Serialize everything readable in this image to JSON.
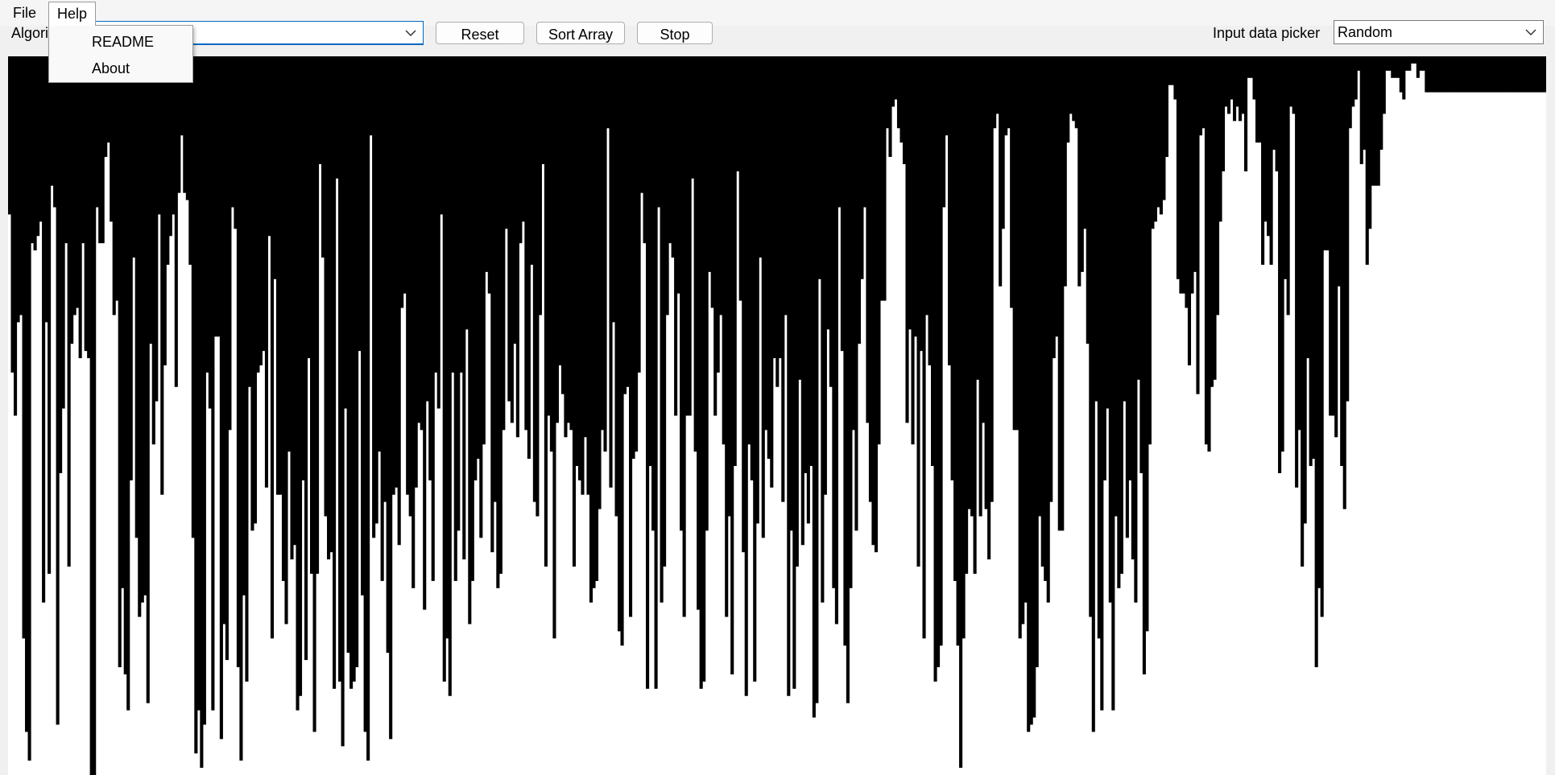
{
  "menu": {
    "file_label": "File",
    "help_label": "Help",
    "help_items": [
      "README",
      "About"
    ]
  },
  "toolbar": {
    "algorithm_label": "Algorithm",
    "algorithm_value": "",
    "reset_label": "Reset",
    "sort_label": "Sort Array",
    "stop_label": "Stop",
    "input_picker_label": "Input data picker",
    "input_picker_value": "Random"
  },
  "colors": {
    "bar": "#000000",
    "canvas_background": "#ffffff",
    "accent": "#0067c0"
  },
  "chart_data": {
    "type": "bar",
    "orientation": "hanging-from-top",
    "ylim": [
      0,
      100
    ],
    "values": [
      22,
      44,
      50,
      37,
      36,
      81,
      94,
      98,
      26,
      27,
      25,
      23,
      76,
      37,
      72,
      18,
      21,
      93,
      58,
      49,
      26,
      71,
      40,
      36,
      35,
      42,
      26,
      41,
      42,
      100,
      100,
      21,
      26,
      26,
      14,
      12,
      23,
      36,
      34,
      85,
      74,
      86,
      91,
      59,
      28,
      67,
      78,
      76,
      75,
      90,
      40,
      54,
      48,
      22,
      61,
      43,
      29,
      25,
      22,
      46,
      19,
      11,
      19,
      20,
      29,
      67,
      97,
      91,
      99,
      93,
      44,
      49,
      91,
      39,
      39,
      95,
      79,
      84,
      52,
      21,
      24,
      85,
      98,
      75,
      87,
      46,
      66,
      65,
      44,
      43,
      41,
      60,
      25,
      81,
      31,
      61,
      61,
      73,
      79,
      55,
      70,
      68,
      91,
      89,
      59,
      84,
      42,
      72,
      94,
      72,
      15,
      28,
      64,
      70,
      69,
      88,
      17,
      87,
      96,
      49,
      83,
      88,
      87,
      85,
      41,
      75,
      94,
      98,
      11,
      67,
      65,
      55,
      73,
      62,
      83,
      95,
      61,
      60,
      68,
      35,
      33,
      61,
      64,
      74,
      60,
      51,
      52,
      77,
      48,
      59,
      73,
      44,
      49,
      22,
      87,
      81,
      89,
      44,
      73,
      66,
      44,
      70,
      38,
      79,
      73,
      59,
      56,
      67,
      54,
      30,
      33,
      69,
      62,
      74,
      72,
      52,
      24,
      48,
      51,
      40,
      53,
      26,
      23,
      52,
      56,
      29,
      62,
      64,
      36,
      15,
      71,
      50,
      55,
      81,
      51,
      43,
      47,
      53,
      51,
      52,
      71,
      57,
      59,
      61,
      53,
      61,
      76,
      74,
      73,
      63,
      52,
      55,
      10,
      60,
      37,
      64,
      80,
      82,
      47,
      46,
      78,
      56,
      55,
      44,
      19,
      26,
      88,
      57,
      66,
      88,
      21,
      76,
      71,
      36,
      26,
      28,
      50,
      33,
      66,
      78,
      50,
      50,
      17,
      55,
      77,
      88,
      87,
      66,
      30,
      35,
      50,
      44,
      36,
      54,
      78,
      64,
      86,
      57,
      16,
      34,
      69,
      89,
      54,
      59,
      87,
      65,
      28,
      67,
      52,
      56,
      60,
      42,
      46,
      42,
      62,
      36,
      89,
      66,
      88,
      71,
      45,
      68,
      58,
      65,
      57,
      92,
      90,
      31,
      76,
      61,
      38,
      46,
      74,
      79,
      21,
      41,
      82,
      90,
      74,
      52,
      66,
      40,
      31,
      21,
      51,
      62,
      68,
      69,
      54,
      34,
      34,
      10,
      14,
      7,
      6,
      10,
      12,
      15,
      51,
      38,
      54,
      39,
      71,
      41,
      81,
      36,
      43,
      57,
      87,
      85,
      82,
      21,
      11,
      43,
      59,
      73,
      82,
      99,
      81,
      72,
      63,
      64,
      72,
      45,
      64,
      51,
      63,
      70,
      62,
      10,
      8,
      32,
      24,
      11,
      10,
      35,
      52,
      52,
      81,
      79,
      76,
      94,
      93,
      92,
      85,
      64,
      71,
      73,
      76,
      62,
      42,
      39,
      66,
      66,
      32,
      12,
      8,
      9,
      10,
      32,
      30,
      24,
      40,
      78,
      94,
      48,
      81,
      91,
      59,
      49,
      76,
      91,
      64,
      74,
      72,
      48,
      67,
      59,
      70,
      76,
      45,
      58,
      86,
      80,
      54,
      24,
      23,
      21,
      22,
      20,
      14,
      4,
      4,
      6,
      31,
      33,
      33,
      35,
      43,
      33,
      30,
      47,
      11,
      10,
      54,
      55,
      46,
      45,
      36,
      23,
      16,
      7,
      8,
      6,
      9,
      7,
      9,
      8,
      16,
      3,
      3,
      6,
      12,
      12,
      29,
      23,
      25,
      29,
      13,
      16,
      58,
      55,
      31,
      36,
      7,
      8,
      60,
      52,
      71,
      65,
      42,
      57,
      56,
      85,
      74,
      78,
      27,
      27,
      50,
      50,
      53,
      32,
      57,
      63,
      48,
      10,
      7,
      6,
      2,
      15,
      13,
      29,
      24,
      18,
      18,
      18,
      13,
      8,
      2,
      2,
      3,
      3,
      3,
      5,
      6,
      2,
      2,
      1,
      1,
      3,
      2,
      2,
      5,
      5,
      5,
      5,
      5,
      5,
      5,
      5,
      5,
      5,
      5,
      5,
      5,
      5,
      5,
      5,
      5,
      5,
      5,
      5,
      5,
      5,
      5,
      5,
      5,
      5,
      5,
      5,
      5,
      5,
      5,
      5,
      5,
      5,
      5,
      5,
      5,
      5,
      5,
      5,
      5,
      5,
      5
    ]
  }
}
